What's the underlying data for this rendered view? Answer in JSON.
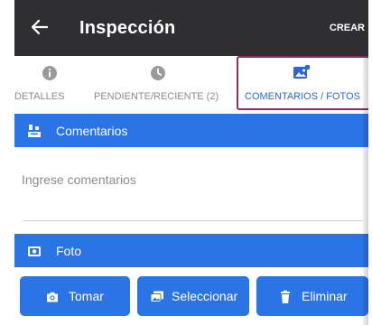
{
  "header": {
    "title": "Inspección",
    "action_label": "CREAR",
    "back_icon": "arrow-left-icon"
  },
  "tabs": [
    {
      "label": "DETALLES",
      "icon": "info-icon",
      "active": false
    },
    {
      "label": "PENDIENTE/RECIENTE (2)",
      "icon": "clock-icon",
      "active": false
    },
    {
      "label": "COMENTARIOS / FOTOS",
      "icon": "image-icon",
      "active": true
    }
  ],
  "comments": {
    "heading": "Comentarios",
    "icon": "comments-icon",
    "placeholder": "Ingrese comentarios"
  },
  "photo": {
    "heading": "Foto",
    "icon": "photo-icon"
  },
  "buttons": [
    {
      "label": "Tomar",
      "icon": "camera-icon"
    },
    {
      "label": "Seleccionar",
      "icon": "gallery-icon"
    },
    {
      "label": "Eliminar",
      "icon": "trash-icon"
    }
  ],
  "colors": {
    "header_bg": "#2f2f31",
    "accent": "#2b74e6",
    "active_tab_text": "#2a66d9",
    "highlight_border": "#8a2e5f"
  }
}
